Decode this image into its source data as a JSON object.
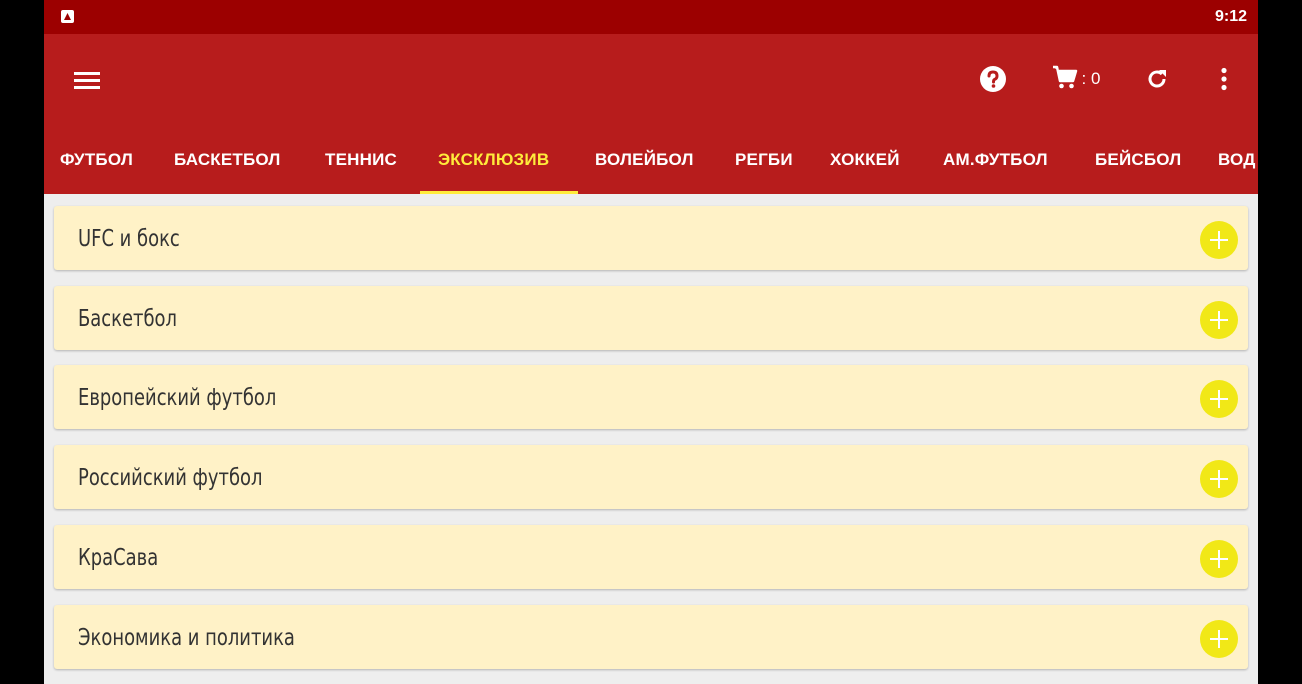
{
  "status_bar": {
    "time": "9:12"
  },
  "toolbar": {
    "cart_count": ": 0"
  },
  "tabs": [
    {
      "label": "ФУТБОЛ"
    },
    {
      "label": "БАСКЕТБОЛ"
    },
    {
      "label": "ТЕННИС"
    },
    {
      "label": "ЭКСКЛЮЗИВ",
      "active": true
    },
    {
      "label": "ВОЛЕЙБОЛ"
    },
    {
      "label": "РЕГБИ"
    },
    {
      "label": "ХОККЕЙ"
    },
    {
      "label": "АМ.ФУТБОЛ"
    },
    {
      "label": "БЕЙСБОЛ"
    },
    {
      "label": "ВОД"
    }
  ],
  "categories": [
    {
      "label": "UFC и бокс"
    },
    {
      "label": "Баскетбол"
    },
    {
      "label": "Европейский футбол"
    },
    {
      "label": "Российский футбол"
    },
    {
      "label": "КраСава"
    },
    {
      "label": "Экономика и политика"
    }
  ],
  "colors": {
    "status_bar": "#9c0000",
    "toolbar": "#b71c1c",
    "active_tab": "#ffeb3b",
    "card_background": "#fff2c7",
    "add_button": "#f1e817"
  }
}
